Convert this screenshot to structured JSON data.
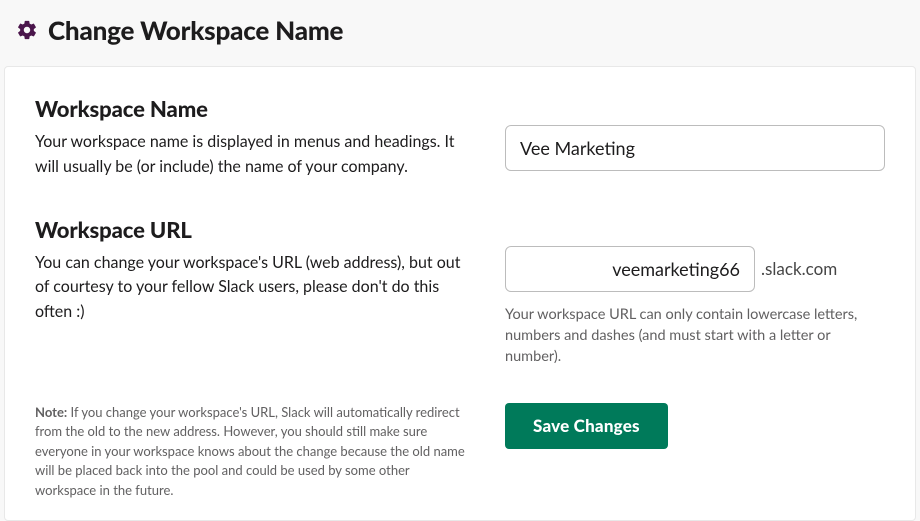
{
  "header": {
    "title": "Change Workspace Name"
  },
  "name_section": {
    "heading": "Workspace Name",
    "description": "Your workspace name is displayed in menus and headings. It will usually be (or include) the name of your company.",
    "value": "Vee Marketing"
  },
  "url_section": {
    "heading": "Workspace URL",
    "description": "You can change your workspace's URL (web address), but out of courtesy to your fellow Slack users, please don't do this often :)",
    "value": "veemarketing66",
    "suffix": ".slack.com",
    "help": "Your workspace URL can only contain lowercase letters, numbers and dashes (and must start with a letter or number)."
  },
  "note": {
    "label": "Note:",
    "text": " If you change your workspace's URL, Slack will automatically redirect from the old to the new address. However, you should still make sure everyone in your workspace knows about the change because the old name will be placed back into the pool and could be used by some other workspace in the future."
  },
  "actions": {
    "save_label": "Save Changes"
  }
}
